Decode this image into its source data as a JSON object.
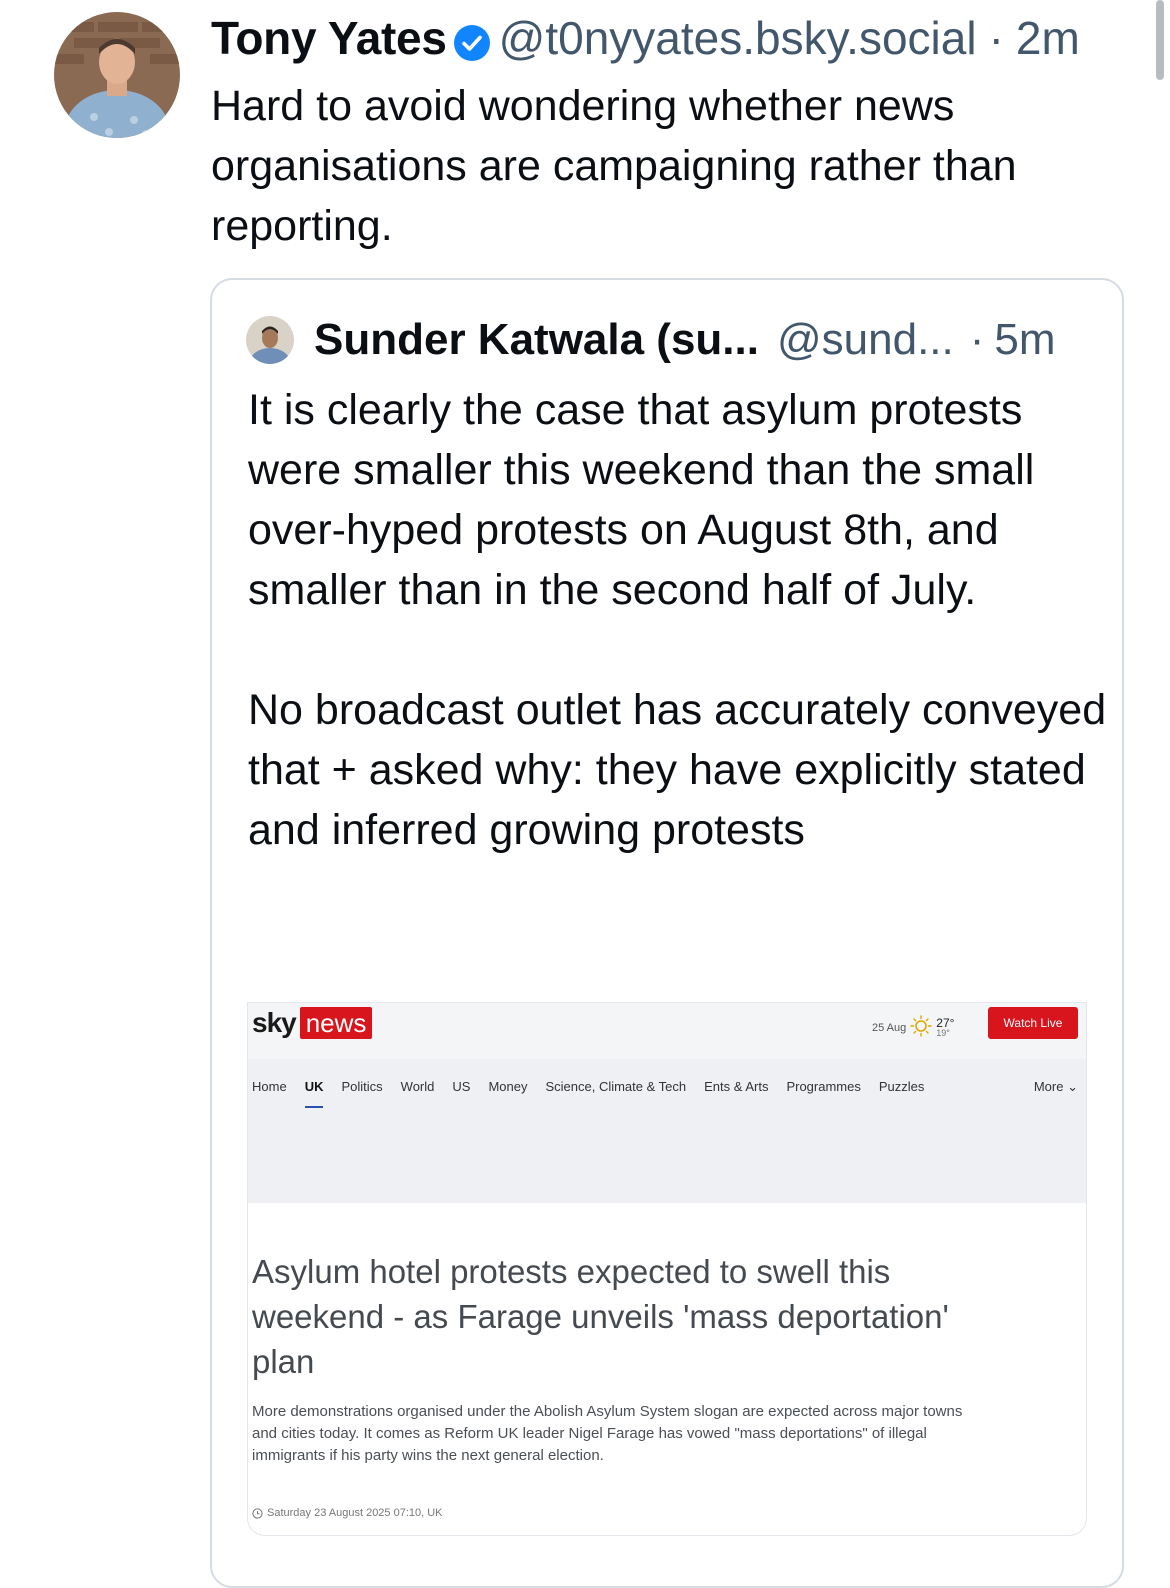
{
  "post": {
    "author_name": "Tony Yates",
    "handle": "@t0nyyates.bsky.social",
    "separator": "·",
    "time": "2m",
    "text": "Hard to avoid wondering whether news organisations are campaigning rather than reporting."
  },
  "quote": {
    "author_name": "Sunder Katwala (su...",
    "handle": "@sund...",
    "separator": "·",
    "time": "5m",
    "paragraphs": [
      "It is clearly the case that asylum protests were smaller this weekend than the small over-hyped protests on August 8th, and smaller than in the second half of July.",
      "No broadcast outlet has accurately conveyed that + asked why: they have explicitly stated and inferred growing protests"
    ]
  },
  "embed": {
    "logo_sky": "sky",
    "logo_news": "news",
    "weather_date": "25 Aug",
    "weather_high": "27°",
    "weather_low": "19°",
    "watch_live": "Watch Live",
    "nav": [
      "Home",
      "UK",
      "Politics",
      "World",
      "US",
      "Money",
      "Science, Climate & Tech",
      "Ents & Arts",
      "Programmes",
      "Puzzles"
    ],
    "nav_active": "UK",
    "nav_more": "More",
    "headline": "Asylum hotel protests expected to swell this weekend - as Farage unveils 'mass deportation' plan",
    "standfirst": "More demonstrations organised under the Abolish Asylum System slogan are expected across major towns and cities today. It comes as Reform UK leader Nigel Farage has vowed \"mass deportations\" of illegal immigrants if his party wins the next general election.",
    "dateline": "Saturday 23 August 2025 07:10, UK"
  },
  "colors": {
    "verified_blue": "#1185fe",
    "sky_red": "#d8141c",
    "muted_text": "#42576c"
  }
}
